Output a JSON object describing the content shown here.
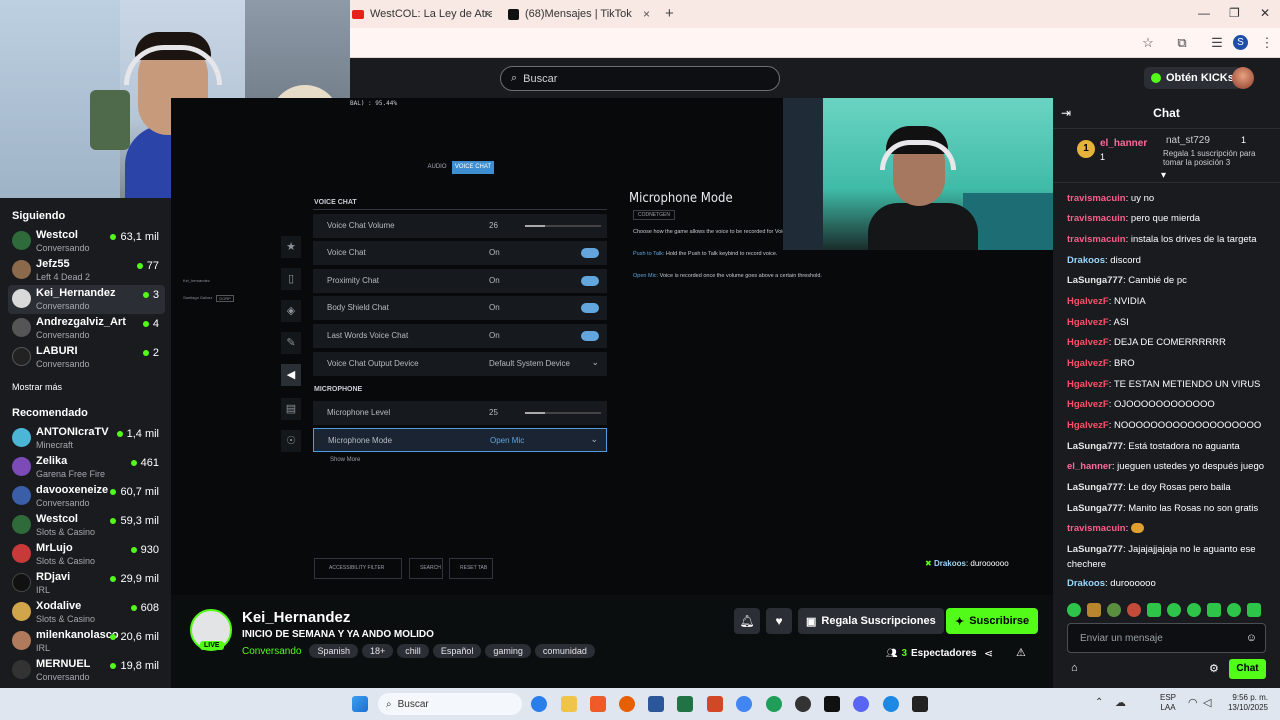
{
  "browser": {
    "tabs": [
      {
        "label": "WestCOL: La Ley de Atracción e",
        "close": "×"
      },
      {
        "label": "(68)Mensajes | TikTok",
        "close": "×"
      }
    ],
    "new_tab": "+"
  },
  "header": {
    "search_placeholder": "Buscar",
    "kicks_button": "Obtén KICKs"
  },
  "sidebar": {
    "following_title": "Siguiendo",
    "following": [
      {
        "name": "Westcol",
        "sub": "Conversando",
        "count": "63,1 mil",
        "color": "#2f6b3a"
      },
      {
        "name": "Jefz55",
        "sub": "Left 4 Dead 2",
        "count": "77",
        "color": "#8b6a4b"
      },
      {
        "name": "Kei_Hernandez",
        "sub": "Conversando",
        "count": "3",
        "color": "#d9d9d9"
      },
      {
        "name": "Andrezgalviz_Art",
        "sub": "Conversando",
        "count": "4",
        "color": "#555"
      },
      {
        "name": "LABURI",
        "sub": "Conversando",
        "count": "2",
        "color": "#222"
      }
    ],
    "show_more": "Mostrar más",
    "recommended_title": "Recomendado",
    "recommended": [
      {
        "name": "ANTONIcraTV",
        "sub": "Minecraft",
        "count": "1,4 mil",
        "color": "#4bb6d6"
      },
      {
        "name": "Zelika",
        "sub": "Garena Free Fire",
        "count": "461",
        "color": "#7c4bb8"
      },
      {
        "name": "davooxeneize",
        "sub": "Conversando",
        "count": "60,7 mil",
        "color": "#3a5fa8"
      },
      {
        "name": "Westcol",
        "sub": "Slots & Casino",
        "count": "59,3 mil",
        "color": "#2f6b3a"
      },
      {
        "name": "MrLujo",
        "sub": "Slots & Casino",
        "count": "930",
        "color": "#c83a3a"
      },
      {
        "name": "RDjavi",
        "sub": "IRL",
        "count": "29,9 mil",
        "color": "#111"
      },
      {
        "name": "Xodalive",
        "sub": "Slots & Casino",
        "count": "608",
        "color": "#d1a64b"
      },
      {
        "name": "milenkanolasco",
        "sub": "IRL",
        "count": "20,6 mil",
        "color": "#b07a5c"
      },
      {
        "name": "MERNUEL",
        "sub": "Conversando",
        "count": "19,8 mil",
        "color": "#333"
      }
    ]
  },
  "game": {
    "tab_audio": "AUDIO",
    "tab_voice": "VOICE CHAT",
    "overlay_top": "BAL) : 95.44%",
    "section_voice": "VOICE CHAT",
    "rows": [
      {
        "label": "Voice Chat Volume",
        "value": "26"
      },
      {
        "label": "Voice Chat",
        "value": "On"
      },
      {
        "label": "Proximity Chat",
        "value": "On"
      },
      {
        "label": "Body Shield Chat",
        "value": "On"
      },
      {
        "label": "Last Words Voice Chat",
        "value": "On"
      },
      {
        "label": "Voice Chat Output Device",
        "value": "Default System Device"
      }
    ],
    "section_mic": "MICROPHONE",
    "mic_level_label": "Microphone Level",
    "mic_level_value": "25",
    "mic_mode_label": "Microphone Mode",
    "mic_mode_value": "Open Mic",
    "show_more": "Show More",
    "panel_title": "Microphone Mode",
    "panel_tag": "CODNETGEN",
    "panel_desc": "Choose how the game allows the voice to be recorded for Voice C",
    "ptt_label": "Push to Talk:",
    "ptt_desc": "Hold the Push to Talk keybind to record voice.",
    "openmic_label": "Open Mic:",
    "openmic_desc": "Voice is recorded once the volume goes above a certain threshold.",
    "footer_accessibility": "ACCESSIBILITY FILTER",
    "footer_search": "SEARCH",
    "footer_reset": "RESET TAB",
    "party_1": "Kei_hernandez",
    "party_2": "Santiago Galvez",
    "party_badge": "DORP",
    "overlay_chat_user": "Drakoos",
    "overlay_chat_text": ": duroooooo"
  },
  "stream": {
    "channel": "Kei_Hernandez",
    "title": "INICIO DE SEMANA Y YA ANDO MOLIDO",
    "category": "Conversando",
    "tags": [
      "Spanish",
      "18+",
      "chill",
      "Español",
      "gaming",
      "comunidad"
    ],
    "live_badge": "LIVE",
    "gift_button": "Regala Suscripciones",
    "subscribe_button": "Suscribirse",
    "viewers_count": "3",
    "viewers_label": "Espectadores"
  },
  "chat": {
    "title": "Chat",
    "leader_1_name": "el_hanner",
    "leader_1_count": "1",
    "leader_2_name": "nat_st729",
    "leader_2_count": "1",
    "leader_2_note": "Regala 1 suscripción para tomar la posición 3",
    "messages": [
      {
        "user": "travismacuin",
        "color": "#ff5c8a",
        "text": "uy no"
      },
      {
        "user": "travismacuin",
        "color": "#ff5c8a",
        "text": "pero que mierda"
      },
      {
        "user": "travismacuin",
        "color": "#ff5c8a",
        "text": "instala los drives de la targeta"
      },
      {
        "user": "Drakoos",
        "color": "#9ad7ff",
        "text": "discord"
      },
      {
        "user": "LaSunga777",
        "color": "#e6e6e6",
        "text": "Cambié de pc"
      },
      {
        "user": "HgalvezF",
        "color": "#ff4f6a",
        "text": "NVIDIA"
      },
      {
        "user": "HgalvezF",
        "color": "#ff4f6a",
        "text": "ASI"
      },
      {
        "user": "HgalvezF",
        "color": "#ff4f6a",
        "text": "DEJA DE COMERRRRRR"
      },
      {
        "user": "HgalvezF",
        "color": "#ff4f6a",
        "text": "BRO"
      },
      {
        "user": "HgalvezF",
        "color": "#ff4f6a",
        "text": "TE ESTAN METIENDO UN VIRUS"
      },
      {
        "user": "HgalvezF",
        "color": "#ff4f6a",
        "text": "OJOOOOOOOOOOOO"
      },
      {
        "user": "HgalvezF",
        "color": "#ff4f6a",
        "text": "NOOOOOOOOOOOOOOOOOOO"
      },
      {
        "user": "LaSunga777",
        "color": "#e6e6e6",
        "text": "Está tostadora no aguanta"
      },
      {
        "user": "el_hanner",
        "color": "#ff6b9a",
        "text": "jueguen ustedes yo después juego"
      },
      {
        "user": "LaSunga777",
        "color": "#e6e6e6",
        "text": "Le doy Rosas pero baila"
      },
      {
        "user": "LaSunga777",
        "color": "#e6e6e6",
        "text": "Manito las Rosas no son gratis"
      },
      {
        "user": "travismacuin",
        "color": "#ff5c8a",
        "text": ""
      },
      {
        "user": "LaSunga777",
        "color": "#e6e6e6",
        "text": "Jajajajjajaja no le aguanto ese chechere"
      },
      {
        "user": "Drakoos",
        "color": "#9ad7ff",
        "text": "duroooooo"
      }
    ],
    "input_placeholder": "Enviar un mensaje",
    "send_button": "Chat"
  },
  "taskbar": {
    "search_placeholder": "Buscar",
    "lang": "ESP",
    "lang_sub": "LAA",
    "time": "9:56 p. m.",
    "date": "13/10/2025"
  }
}
